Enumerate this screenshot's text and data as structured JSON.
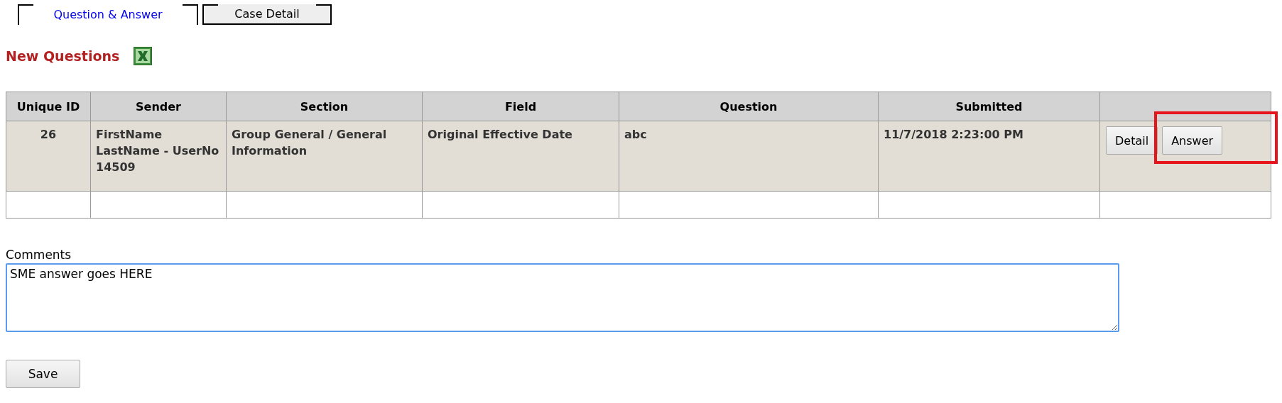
{
  "tabs": [
    {
      "label": "Question & Answer",
      "selected": true
    },
    {
      "label": "Case Detail",
      "selected": false
    }
  ],
  "heading": "New Questions",
  "table": {
    "columns": [
      "Unique ID",
      "Sender",
      "Section",
      "Field",
      "Question",
      "Submitted",
      ""
    ],
    "rows": [
      {
        "cells": [
          "26",
          "FirstName LastName - UserNo 14509",
          "Group General / General Information",
          "Original Effective Date",
          "abc",
          "11/7/2018 2:23:00 PM"
        ],
        "buttons": [
          "Detail",
          "Answer"
        ],
        "highlighted": true
      }
    ]
  },
  "comments": {
    "label": "Comments",
    "value": "SME answer goes HERE"
  },
  "save_button": "Save"
}
